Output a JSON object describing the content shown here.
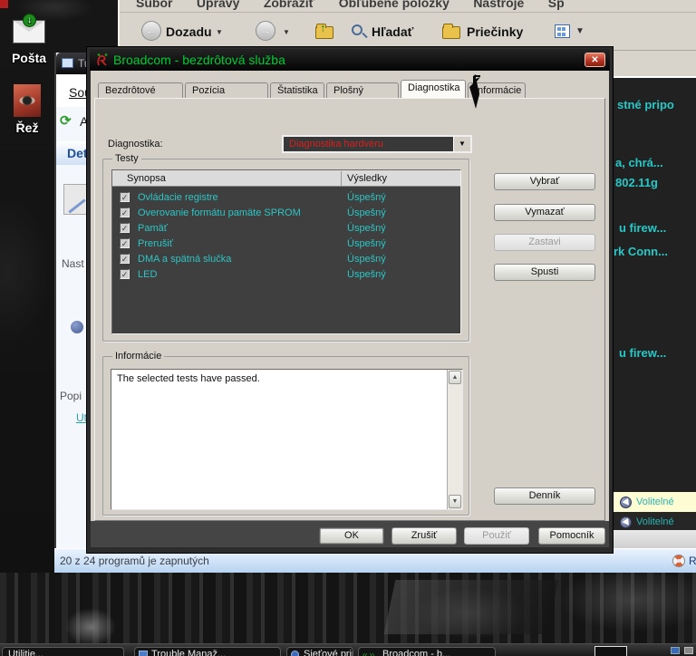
{
  "desktop": {
    "icons": [
      {
        "label": "Pošta"
      },
      {
        "label": "Řež"
      }
    ]
  },
  "explorer": {
    "menu": [
      "Súbor",
      "Úpravy",
      "Zobraziť",
      "Obľúbené položky",
      "Nástroje",
      "Sp"
    ],
    "toolbar": {
      "back": "Dozadu",
      "search": "Hľadať",
      "folders": "Priečinky"
    },
    "net_fragments": [
      "stné pripo",
      "a, chrá...",
      "802.11g",
      "u firew...",
      "rk Conn...",
      "u firew..."
    ],
    "optional_rows": [
      {
        "label": "Volitelné"
      },
      {
        "label": "Volitelné"
      }
    ],
    "help_fragment": "R"
  },
  "tuneup": {
    "title_fragment": "Tu",
    "menu_fragment": "Sou",
    "refresh_fragment": "A",
    "details_fragment": "Deta",
    "settings_fragment": "Nast",
    "description_fragment": "Popi",
    "link_fragment": "Ut"
  },
  "statusbar": {
    "text": "20 z 24 programů je zapnutých"
  },
  "dialog": {
    "title": "Broadcom - bezdrôtová služba",
    "tabs": [
      {
        "label": "Bezdrôtové siete"
      },
      {
        "label": "Pozícia spojenia"
      },
      {
        "label": "Štatistika"
      },
      {
        "label": "Plošný monitor"
      },
      {
        "label": "Diagnostika",
        "active": true
      },
      {
        "label": "Informácie"
      }
    ],
    "diagnostics_label": "Diagnostika:",
    "diagnostics_value": "Diagnostika hardvéru",
    "tests_group": "Testy",
    "columns": [
      "Synopsa",
      "Výsledky"
    ],
    "tests": [
      {
        "name": "Ovládacie registre",
        "result": "Úspešný"
      },
      {
        "name": "Overovanie formátu pamäte SPROM",
        "result": "Úspešný"
      },
      {
        "name": "Pamäť",
        "result": "Úspešný"
      },
      {
        "name": "Prerušiť",
        "result": "Úspešný"
      },
      {
        "name": "DMA a spätná slučka",
        "result": "Úspešný"
      },
      {
        "name": "LED",
        "result": "Úspešný"
      }
    ],
    "side_buttons": [
      {
        "label": "Vybrať"
      },
      {
        "label": "Vymazať"
      },
      {
        "label": "Zastavi",
        "disabled": true
      },
      {
        "label": "Spusti"
      }
    ],
    "info_group": "Informácie",
    "info_text": "The selected tests have passed.",
    "log_button": "Denník",
    "bottom_buttons": [
      {
        "label": "OK",
        "default": true
      },
      {
        "label": "Zrušiť"
      },
      {
        "label": "Použiť",
        "disabled": true
      },
      {
        "label": "Pomocník"
      }
    ]
  },
  "taskbar": {
    "buttons": [
      {
        "label": "Utilitie..."
      },
      {
        "label": "Trouble Manaž..."
      },
      {
        "label": "Sieťové pripojeni..."
      },
      {
        "label": "Broadcom - b..."
      }
    ]
  },
  "icons": {
    "dropdown_arrow": "▼",
    "scroll_up": "▲",
    "scroll_down": "▼",
    "check": "✓",
    "close_x": "✕",
    "back_arrow": "←",
    "forward_arrow": "→",
    "up_arrow": "↑",
    "mail_arrow": "↓",
    "wireless_glyph": "((·))"
  },
  "colors": {
    "title_green": "#00cc33",
    "combo_red": "#d42020",
    "result_teal": "#2cc5c5",
    "net_cyan": "#28c8c8",
    "close_red": "#b03220",
    "status_blue": "#b6d2f0",
    "selected_row_yellow": "#fdfcd2"
  }
}
